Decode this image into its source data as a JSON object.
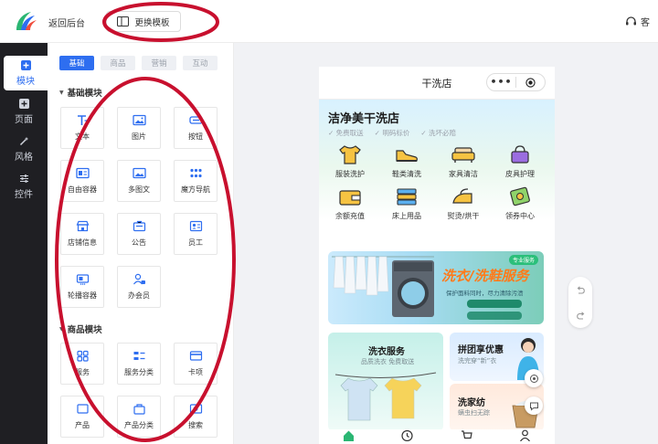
{
  "header": {
    "back_label": "返回后台",
    "template_label": "更换模板",
    "right_label": "客"
  },
  "leftnav": {
    "items": [
      {
        "label": "模块",
        "icon": "plus-square-icon",
        "active": true
      },
      {
        "label": "页面",
        "icon": "plus-square-icon",
        "active": false
      },
      {
        "label": "风格",
        "icon": "magic-wand-icon",
        "active": false
      },
      {
        "label": "控件",
        "icon": "sliders-icon",
        "active": false
      }
    ]
  },
  "panel": {
    "tabs": [
      "基础",
      "商品",
      "营销",
      "互动"
    ],
    "active_tab": "基础",
    "sections": [
      {
        "title": "基础模块",
        "items": [
          "文本",
          "图片",
          "按钮",
          "自由容器",
          "多图文",
          "魔方导航",
          "店铺信息",
          "公告",
          "员工",
          "轮播容器",
          "办会员"
        ]
      },
      {
        "title": "商品模块",
        "items": [
          "服务",
          "服务分类",
          "卡项",
          "产品",
          "产品分类",
          "搜索"
        ]
      }
    ]
  },
  "phone": {
    "title": "干洗店",
    "shop_name": "洁净美干洗店",
    "badges": [
      "免费取送",
      "明码标价",
      "洗坏必赔"
    ],
    "services": [
      "服装洗护",
      "鞋类清洗",
      "家具清洁",
      "皮具护理",
      "余额充值",
      "床上用品",
      "熨烫/烘干",
      "领券中心"
    ],
    "banner": {
      "tag": "专业服务",
      "title": "洗衣/洗鞋服务",
      "subtitle": "保护面料同时，尽力清除污渍"
    },
    "cards": [
      {
        "title": "洗衣服务",
        "subtitle": "品质洗衣  免费取送"
      },
      {
        "title": "拼团享优惠",
        "subtitle": "洗完穿“新”衣"
      },
      {
        "title": "洗家纺",
        "subtitle": "螨虫扫无踪"
      }
    ]
  },
  "colors": {
    "accent": "#2e6ef0",
    "nav_bg": "#1f1f23",
    "canvas_bg": "#f1f2f5",
    "annotation": "#c8102e"
  }
}
